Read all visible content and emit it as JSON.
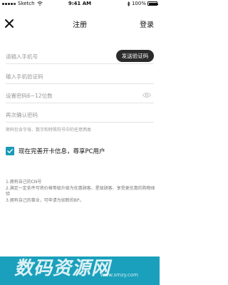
{
  "status_bar": {
    "carrier": "Sketch",
    "time": "9:41 AM",
    "battery_percent": 100
  },
  "nav": {
    "title": "注册",
    "login": "登录"
  },
  "form": {
    "phone_placeholder": "请输入手机号",
    "send_code_label": "发送验证码",
    "code_placeholder": "输入手机验证码",
    "password_placeholder": "设置密码6~12位数",
    "confirm_placeholder": "再次确认密码",
    "password_hint": "密码包含字母、数字和特殊符号中的任意两类"
  },
  "promo": {
    "checked": true,
    "text": "现在完善开卡信息，尊享PC用户"
  },
  "benefits": [
    "1.拥有自己的CN号",
    "2.满足一定条件可将价格等级升级为优惠顾客、星级顾客、享受更优惠的购物体验",
    "3.拥有自己的事业，可申请为如新的BP。"
  ],
  "watermark": {
    "text": "数码资源网",
    "url": "www.smzy.com"
  }
}
